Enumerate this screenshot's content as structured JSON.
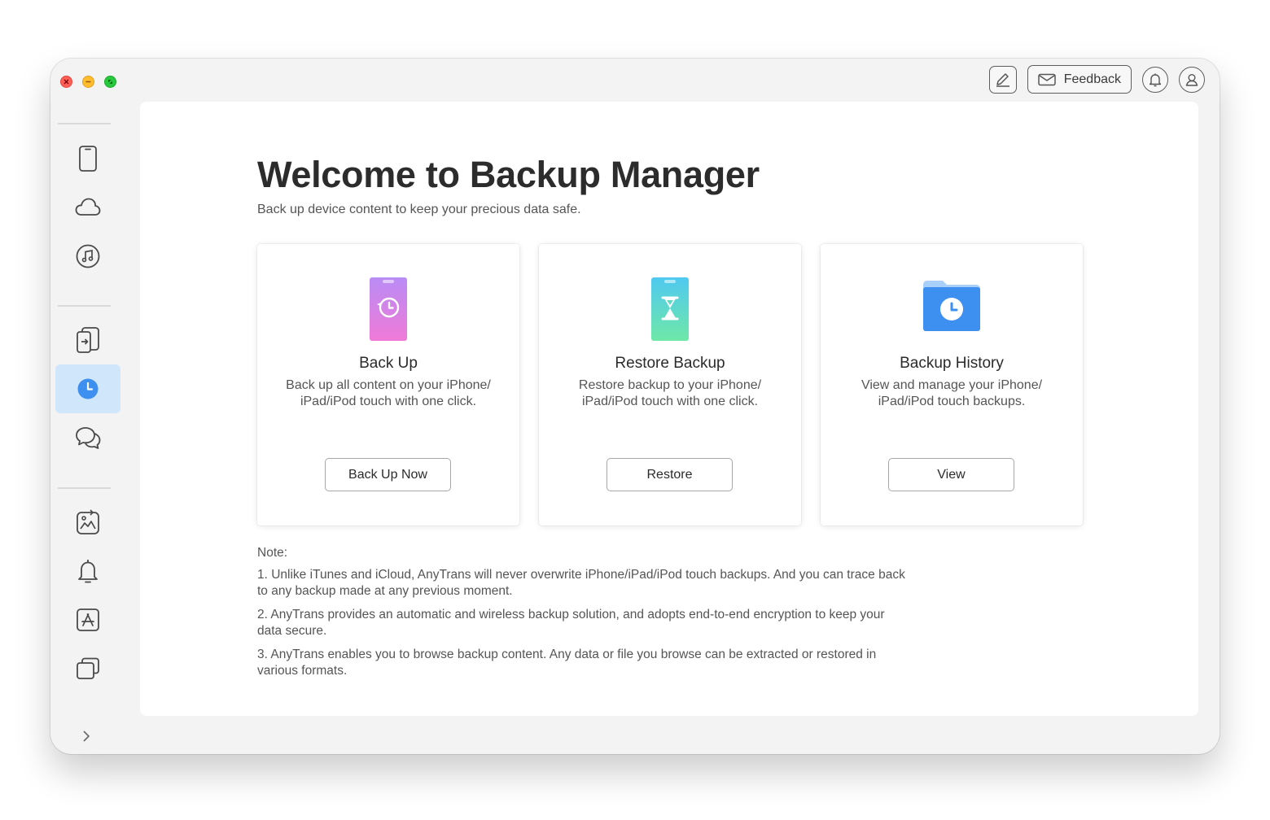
{
  "window": {
    "traffic_lights": [
      "close",
      "minimize",
      "zoom"
    ]
  },
  "toolbar": {
    "edit_icon": "edit-icon",
    "feedback_label": "Feedback",
    "feedback_icon": "envelope-icon",
    "notifications_icon": "bell-icon",
    "account_icon": "user-icon"
  },
  "sidebar": {
    "items": [
      {
        "id": "device",
        "icon": "phone-icon"
      },
      {
        "id": "icloud",
        "icon": "cloud-icon"
      },
      {
        "id": "itunes",
        "icon": "music-icon"
      },
      {
        "id": "transfer",
        "icon": "phone-transfer-icon"
      },
      {
        "id": "backup-manager",
        "icon": "backup-clock-icon",
        "active": true
      },
      {
        "id": "messages",
        "icon": "chat-bubbles-icon"
      },
      {
        "id": "photos",
        "icon": "photo-sync-icon"
      },
      {
        "id": "ringtones",
        "icon": "bell-icon"
      },
      {
        "id": "app-store",
        "icon": "app-store-icon"
      },
      {
        "id": "more",
        "icon": "stacked-windows-icon"
      }
    ],
    "expand_icon": "chevron-right-icon"
  },
  "main": {
    "title": "Welcome to Backup Manager",
    "subtitle": "Back up device content to keep your precious data safe.",
    "cards": [
      {
        "title": "Back Up",
        "desc_line1": "Back up all content on your iPhone/",
        "desc_line2": "iPad/iPod touch with one click.",
        "button": "Back Up Now"
      },
      {
        "title": "Restore Backup",
        "desc_line1": "Restore backup to your iPhone/",
        "desc_line2": "iPad/iPod touch with one click.",
        "button": "Restore"
      },
      {
        "title": "Backup History",
        "desc_line1": "View and manage your iPhone/",
        "desc_line2": "iPad/iPod touch backups.",
        "button": "View"
      }
    ],
    "notes": {
      "heading": "Note:",
      "items": [
        {
          "line1": "1. Unlike iTunes and iCloud, AnyTrans will never overwrite iPhone/iPad/iPod touch backups. And you can trace back",
          "line2": "to any backup made at any previous moment."
        },
        {
          "line1": "2. AnyTrans provides an automatic and wireless backup solution, and adopts end-to-end encryption to keep your",
          "line2": "data secure."
        },
        {
          "line1": "3. AnyTrans enables you to browse backup content. Any data or file you browse can be extracted or restored in",
          "line2": "various formats."
        }
      ]
    }
  },
  "colors": {
    "accent": "#3d8ff0",
    "active_nav_bg": "#cfe6fb",
    "backup_gradient": [
      "#b98cf5",
      "#f07ad8"
    ],
    "restore_gradient": [
      "#4fc9f0",
      "#6fe8a8"
    ],
    "history_folder": "#3d8ff0"
  }
}
